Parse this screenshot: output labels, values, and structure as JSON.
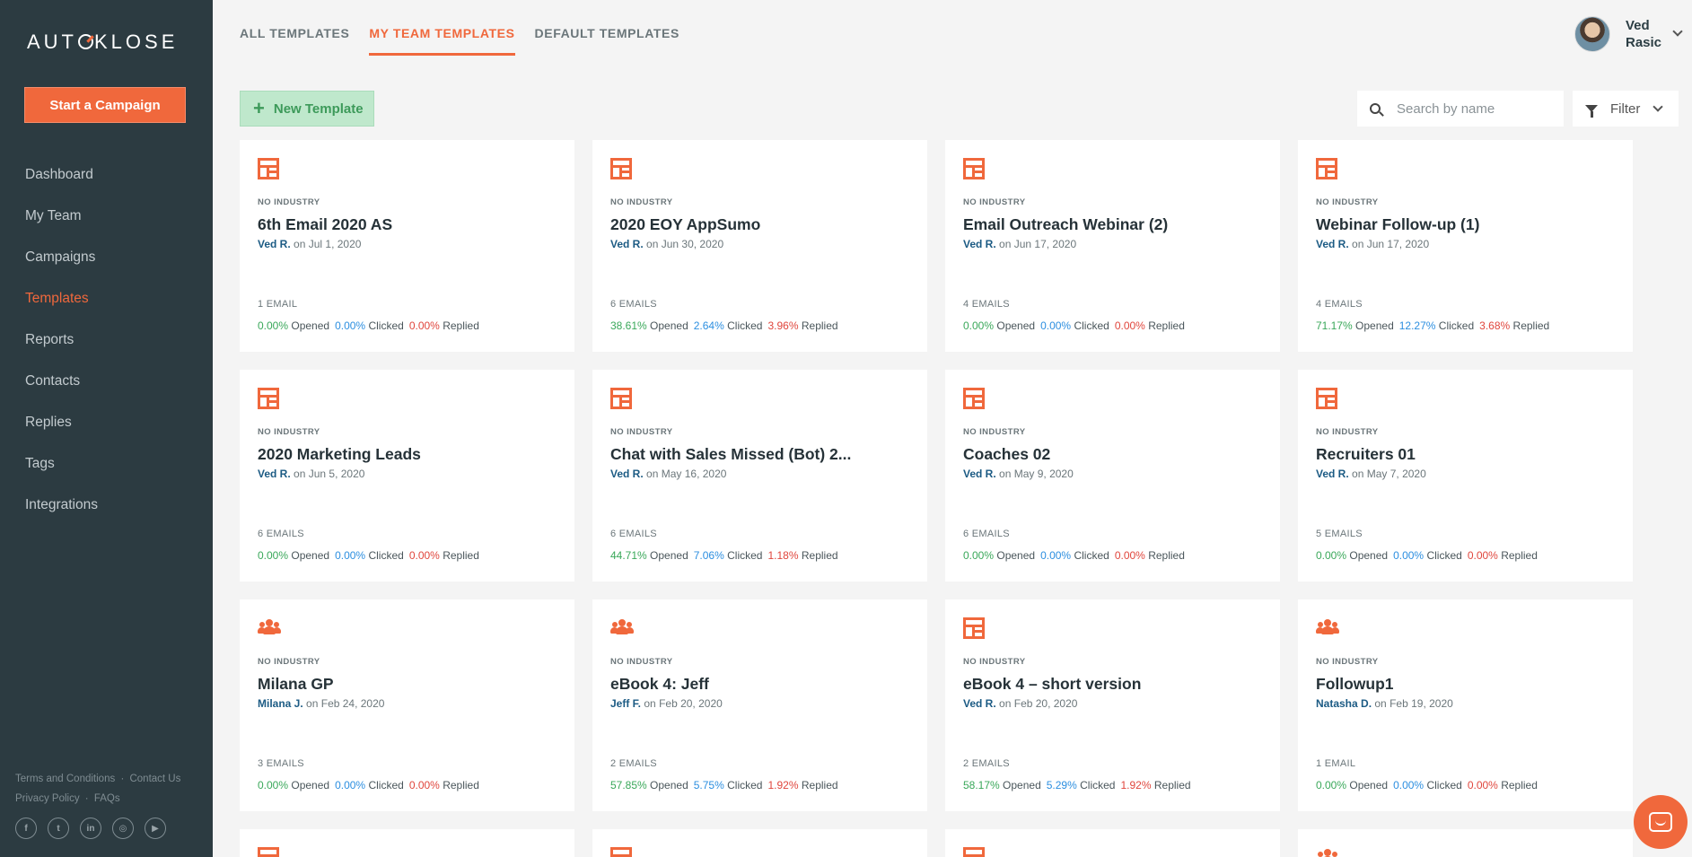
{
  "brand": {
    "logo_prefix": "AUT",
    "logo_suffix": "KLOSE",
    "accent": "#f0683c"
  },
  "sidebar": {
    "cta": "Start a Campaign",
    "items": [
      {
        "label": "Dashboard"
      },
      {
        "label": "My Team"
      },
      {
        "label": "Campaigns"
      },
      {
        "label": "Templates",
        "active": true
      },
      {
        "label": "Reports"
      },
      {
        "label": "Contacts"
      },
      {
        "label": "Replies"
      },
      {
        "label": "Tags"
      },
      {
        "label": "Integrations"
      }
    ],
    "footer": {
      "terms": "Terms and Conditions",
      "contact": "Contact Us",
      "privacy": "Privacy Policy",
      "faqs": "FAQs",
      "sep": "·"
    },
    "socials": [
      {
        "icon": "facebook-icon",
        "glyph": "f"
      },
      {
        "icon": "twitter-icon",
        "glyph": "t"
      },
      {
        "icon": "linkedin-icon",
        "glyph": "in"
      },
      {
        "icon": "instagram-icon",
        "glyph": "◎"
      },
      {
        "icon": "youtube-icon",
        "glyph": "▶"
      }
    ]
  },
  "header": {
    "tabs": [
      {
        "label": "ALL TEMPLATES"
      },
      {
        "label": "MY TEAM TEMPLATES",
        "active": true
      },
      {
        "label": "DEFAULT TEMPLATES"
      }
    ],
    "user": {
      "first": "Ved",
      "last": "Rasic"
    }
  },
  "toolbar": {
    "new_template": "New Template",
    "search_placeholder": "Search by name",
    "filter": "Filter"
  },
  "stat_labels": {
    "opened": "Opened",
    "clicked": "Clicked",
    "replied": "Replied"
  },
  "cards": [
    {
      "icon": "template",
      "industry": "NO INDUSTRY",
      "title": "6th Email 2020 AS",
      "author": "Ved R.",
      "on": "on",
      "date": "Jul 1, 2020",
      "emails": "1 EMAIL",
      "opened": "0.00%",
      "clicked": "0.00%",
      "replied": "0.00%"
    },
    {
      "icon": "template",
      "industry": "NO INDUSTRY",
      "title": "2020 EOY AppSumo",
      "author": "Ved R.",
      "on": "on",
      "date": "Jun 30, 2020",
      "emails": "6 EMAILS",
      "opened": "38.61%",
      "clicked": "2.64%",
      "replied": "3.96%"
    },
    {
      "icon": "template",
      "industry": "NO INDUSTRY",
      "title": "Email Outreach Webinar (2)",
      "author": "Ved R.",
      "on": "on",
      "date": "Jun 17, 2020",
      "emails": "4 EMAILS",
      "opened": "0.00%",
      "clicked": "0.00%",
      "replied": "0.00%"
    },
    {
      "icon": "template",
      "industry": "NO INDUSTRY",
      "title": "Webinar Follow-up (1)",
      "author": "Ved R.",
      "on": "on",
      "date": "Jun 17, 2020",
      "emails": "4 EMAILS",
      "opened": "71.17%",
      "clicked": "12.27%",
      "replied": "3.68%"
    },
    {
      "icon": "template",
      "industry": "NO INDUSTRY",
      "title": "2020 Marketing Leads",
      "author": "Ved R.",
      "on": "on",
      "date": "Jun 5, 2020",
      "emails": "6 EMAILS",
      "opened": "0.00%",
      "clicked": "0.00%",
      "replied": "0.00%"
    },
    {
      "icon": "template",
      "industry": "NO INDUSTRY",
      "title": "Chat with Sales Missed (Bot) 2...",
      "author": "Ved R.",
      "on": "on",
      "date": "May 16, 2020",
      "emails": "6 EMAILS",
      "opened": "44.71%",
      "clicked": "7.06%",
      "replied": "1.18%"
    },
    {
      "icon": "template",
      "industry": "NO INDUSTRY",
      "title": "Coaches 02",
      "author": "Ved R.",
      "on": "on",
      "date": "May 9, 2020",
      "emails": "6 EMAILS",
      "opened": "0.00%",
      "clicked": "0.00%",
      "replied": "0.00%"
    },
    {
      "icon": "template",
      "industry": "NO INDUSTRY",
      "title": "Recruiters 01",
      "author": "Ved R.",
      "on": "on",
      "date": "May 7, 2020",
      "emails": "5 EMAILS",
      "opened": "0.00%",
      "clicked": "0.00%",
      "replied": "0.00%"
    },
    {
      "icon": "team",
      "industry": "NO INDUSTRY",
      "title": "Milana GP",
      "author": "Milana J.",
      "on": "on",
      "date": "Feb 24, 2020",
      "emails": "3 EMAILS",
      "opened": "0.00%",
      "clicked": "0.00%",
      "replied": "0.00%"
    },
    {
      "icon": "team",
      "industry": "NO INDUSTRY",
      "title": "eBook 4: Jeff",
      "author": "Jeff F.",
      "on": "on",
      "date": "Feb 20, 2020",
      "emails": "2 EMAILS",
      "opened": "57.85%",
      "clicked": "5.75%",
      "replied": "1.92%"
    },
    {
      "icon": "template",
      "industry": "NO INDUSTRY",
      "title": "eBook 4 – short version",
      "author": "Ved R.",
      "on": "on",
      "date": "Feb 20, 2020",
      "emails": "2 EMAILS",
      "opened": "58.17%",
      "clicked": "5.29%",
      "replied": "1.92%"
    },
    {
      "icon": "team",
      "industry": "NO INDUSTRY",
      "title": "Followup1",
      "author": "Natasha D.",
      "on": "on",
      "date": "Feb 19, 2020",
      "emails": "1 EMAIL",
      "opened": "0.00%",
      "clicked": "0.00%",
      "replied": "0.00%"
    }
  ],
  "partial_cards": [
    {
      "icon": "template"
    },
    {
      "icon": "template"
    },
    {
      "icon": "template"
    },
    {
      "icon": "team"
    }
  ]
}
